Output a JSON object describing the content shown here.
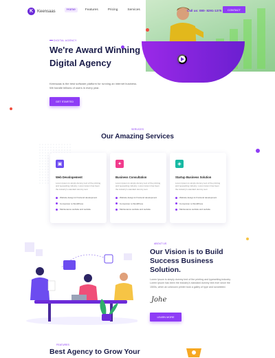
{
  "header": {
    "logo_letter": "K",
    "logo_text": "Keensaas",
    "nav": [
      "Home",
      "Features",
      "Pricing",
      "Services",
      "FAQs"
    ],
    "phone": "Call us: 080- 8291-1375",
    "contact_label": "CONTACT"
  },
  "hero": {
    "eyebrow": "DIGITAL AGENCY",
    "title": "We're Award Winning Digital Agency",
    "description": "Keensaas is the best software platform for running an internet business. We handle billions of users in every year.",
    "cta_label": "GET STARTED"
  },
  "services": {
    "eyebrow": "SERVICES",
    "title": "Our Amazing Services",
    "cards": [
      {
        "icon": "window-icon",
        "icon_color": "#6c4cf0",
        "title": "Web Devolopement",
        "description": "Lorem Ipsum is simply dummy text of the printing and typesetting industry. Lorem Ipsum has been the industry's standard dummy text.",
        "items": [
          "Website design & Frontend development",
          "Conversion to WordPress",
          "Maintenance website and website"
        ]
      },
      {
        "icon": "bulb-icon",
        "icon_color": "#f13b8c",
        "title": "Business Consultation",
        "description": "Lorem Ipsum is simply dummy text of the printing and typesetting industry. Lorem Ipsum has been the industry's standard dummy text.",
        "items": [
          "Website design & Frontend development",
          "Conversion to WordPress",
          "Maintenance website and website"
        ]
      },
      {
        "icon": "layers-icon",
        "icon_color": "#17b9a3",
        "title": "Startup Business Solution",
        "description": "Lorem Ipsum is simply dummy text of the printing and typesetting industry. Lorem Ipsum has been the industry's standard dummy text.",
        "items": [
          "Website design & Frontend development",
          "Conversion to WordPress",
          "Maintenance website and website"
        ]
      }
    ]
  },
  "vision": {
    "eyebrow": "ABOUT US",
    "title": "Our Vision is to Build Success Business Solution.",
    "description": "Lorem Ipsum is simply dummy text of the printing and typesetting industry. Lorem Ipsum has been the industry's standard dummy text ever since the 1500s, when an unknown printer took a galley of type and scrambled.",
    "signature": "Johe",
    "cta_label": "LEARN MORE"
  },
  "features": {
    "eyebrow": "FEATURES",
    "title": "Best Agency to Grow Your"
  },
  "colors": {
    "accent": "#8e3cf6",
    "heading": "#1b1d4a"
  }
}
